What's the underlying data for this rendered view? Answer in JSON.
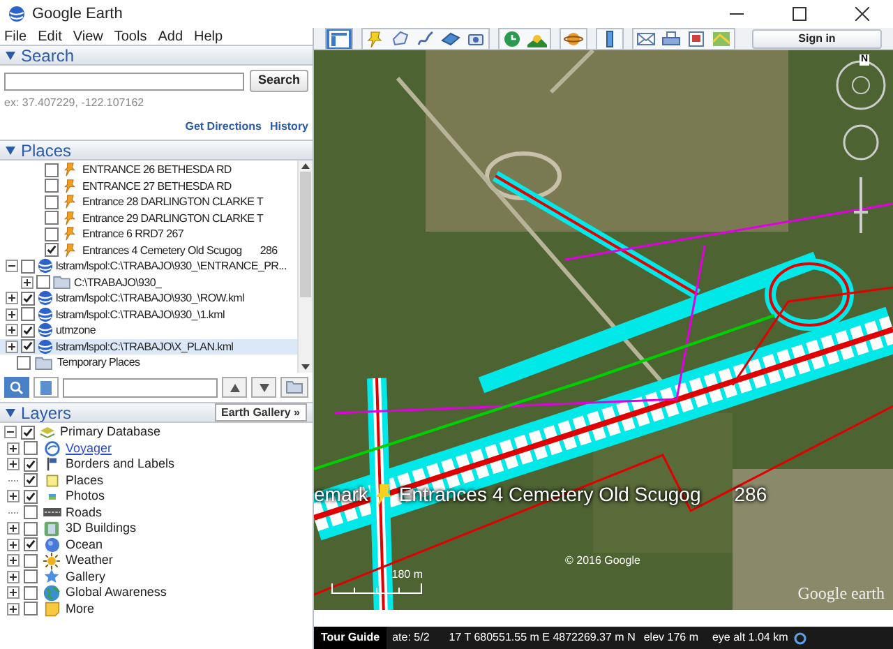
{
  "window": {
    "title": "Google Earth"
  },
  "menu": [
    "File",
    "Edit",
    "View",
    "Tools",
    "Add",
    "Help"
  ],
  "search": {
    "title": "Search",
    "expanded": true,
    "button": "Search",
    "example": "ex: 37.407229, -122.107162",
    "links": [
      "Get Directions",
      "History"
    ]
  },
  "places": {
    "title": "Places",
    "expanded": true,
    "scrolled_branch": [
      {
        "label": "ENTRANCE 26 BETHESDA RD",
        "checked": false,
        "kind": "pin"
      },
      {
        "label": "ENTRANCE 27 BETHESDA RD",
        "checked": false,
        "kind": "pin"
      },
      {
        "label": "Entrance 28 DARLINGTON CLARKE T",
        "checked": false,
        "kind": "pin"
      },
      {
        "label": "Entrance 29 DARLINGTON CLARKE T",
        "checked": false,
        "kind": "pin"
      },
      {
        "label": "Entrance 6  RRD7 267",
        "checked": false,
        "kind": "pin"
      },
      {
        "label": "Entrances 4 Cemetery Old Scugog",
        "extra": "286",
        "checked": true,
        "kind": "pin"
      }
    ],
    "items": [
      {
        "label": "lstram/lspol:C:\\TRABAJO\\930_\\ENTRANCE_PR...",
        "checked": false,
        "kind": "globe",
        "expanded": true,
        "selected": false,
        "children": [
          {
            "label": "C:\\TRABAJO\\930_",
            "checked": false,
            "kind": "folder",
            "expanded": false,
            "selected": false
          }
        ]
      },
      {
        "label": "lstram/lspol:C:\\TRABAJO\\930_\\ROW.kml",
        "checked": true,
        "kind": "globe",
        "expanded": false,
        "selected": false
      },
      {
        "label": "lstram/lspol:C:\\TRABAJO\\930_\\1.kml",
        "checked": false,
        "kind": "globe",
        "expanded": false,
        "selected": false
      },
      {
        "label": "utmzone",
        "checked": true,
        "kind": "globe",
        "expanded": false,
        "selected": false
      },
      {
        "label": "lstram/lspol:C:\\TRABAJO\\X_PLAN.kml",
        "checked": true,
        "kind": "globe",
        "expanded": false,
        "selected": true
      }
    ],
    "temporary": {
      "label": "Temporary Places",
      "checked": false,
      "kind": "folder"
    }
  },
  "layers": {
    "title": "Layers",
    "expanded": true,
    "gallery_button": "Earth Gallery »",
    "root": {
      "label": "Primary Database",
      "checked": true,
      "expanded": true,
      "children": [
        {
          "label": "Voyager",
          "checked": false,
          "kind": "voyager",
          "expandable": true
        },
        {
          "label": "Borders and Labels",
          "checked": true,
          "kind": "flag",
          "expandable": true
        },
        {
          "label": "Places",
          "checked": true,
          "kind": "square",
          "expandable": false
        },
        {
          "label": "Photos",
          "checked": true,
          "kind": "photo",
          "expandable": true
        },
        {
          "label": "Roads",
          "checked": false,
          "kind": "road",
          "expandable": false
        },
        {
          "label": "3D Buildings",
          "checked": false,
          "kind": "building",
          "expandable": true
        },
        {
          "label": "Ocean",
          "checked": true,
          "kind": "ocean",
          "expandable": true
        },
        {
          "label": "Weather",
          "checked": false,
          "kind": "sun",
          "expandable": true
        },
        {
          "label": "Gallery",
          "checked": false,
          "kind": "star",
          "expandable": true
        },
        {
          "label": "Global Awareness",
          "checked": false,
          "kind": "earth",
          "expandable": true
        },
        {
          "label": "More",
          "checked": false,
          "kind": "note",
          "expandable": true
        }
      ]
    }
  },
  "toolbar": {
    "buttons": [
      {
        "kind": "sidebar",
        "selected": true
      },
      {
        "kind": "placemark",
        "selected": false
      },
      {
        "kind": "polygon",
        "selected": false
      },
      {
        "kind": "path",
        "selected": false
      },
      {
        "kind": "overlay",
        "selected": false
      },
      {
        "kind": "tour",
        "selected": false
      },
      {
        "kind": "history",
        "selected": false
      },
      {
        "kind": "sun",
        "selected": false
      },
      {
        "kind": "planet",
        "selected": false
      },
      {
        "kind": "ruler",
        "selected": false
      },
      {
        "kind": "email",
        "selected": false
      },
      {
        "kind": "print",
        "selected": false
      },
      {
        "kind": "save",
        "selected": false
      },
      {
        "kind": "maps",
        "selected": false
      }
    ],
    "sign_in": "Sign in"
  },
  "map": {
    "compass_letter": "N",
    "label_left": "emark",
    "label": "Entrances 4 Cemetery Old Scugog",
    "label_number": "286",
    "copyright": "© 2016 Google",
    "logo": "Google earth",
    "scale": "180 m",
    "status": {
      "tour_guide": "Tour Guide",
      "date": "ate: 5/2",
      "coordinates": "17 T 680551.55 m E 4872269.37 m N",
      "elevation": "elev   176 m",
      "eye_alt": "eye alt  1.04 km"
    }
  }
}
